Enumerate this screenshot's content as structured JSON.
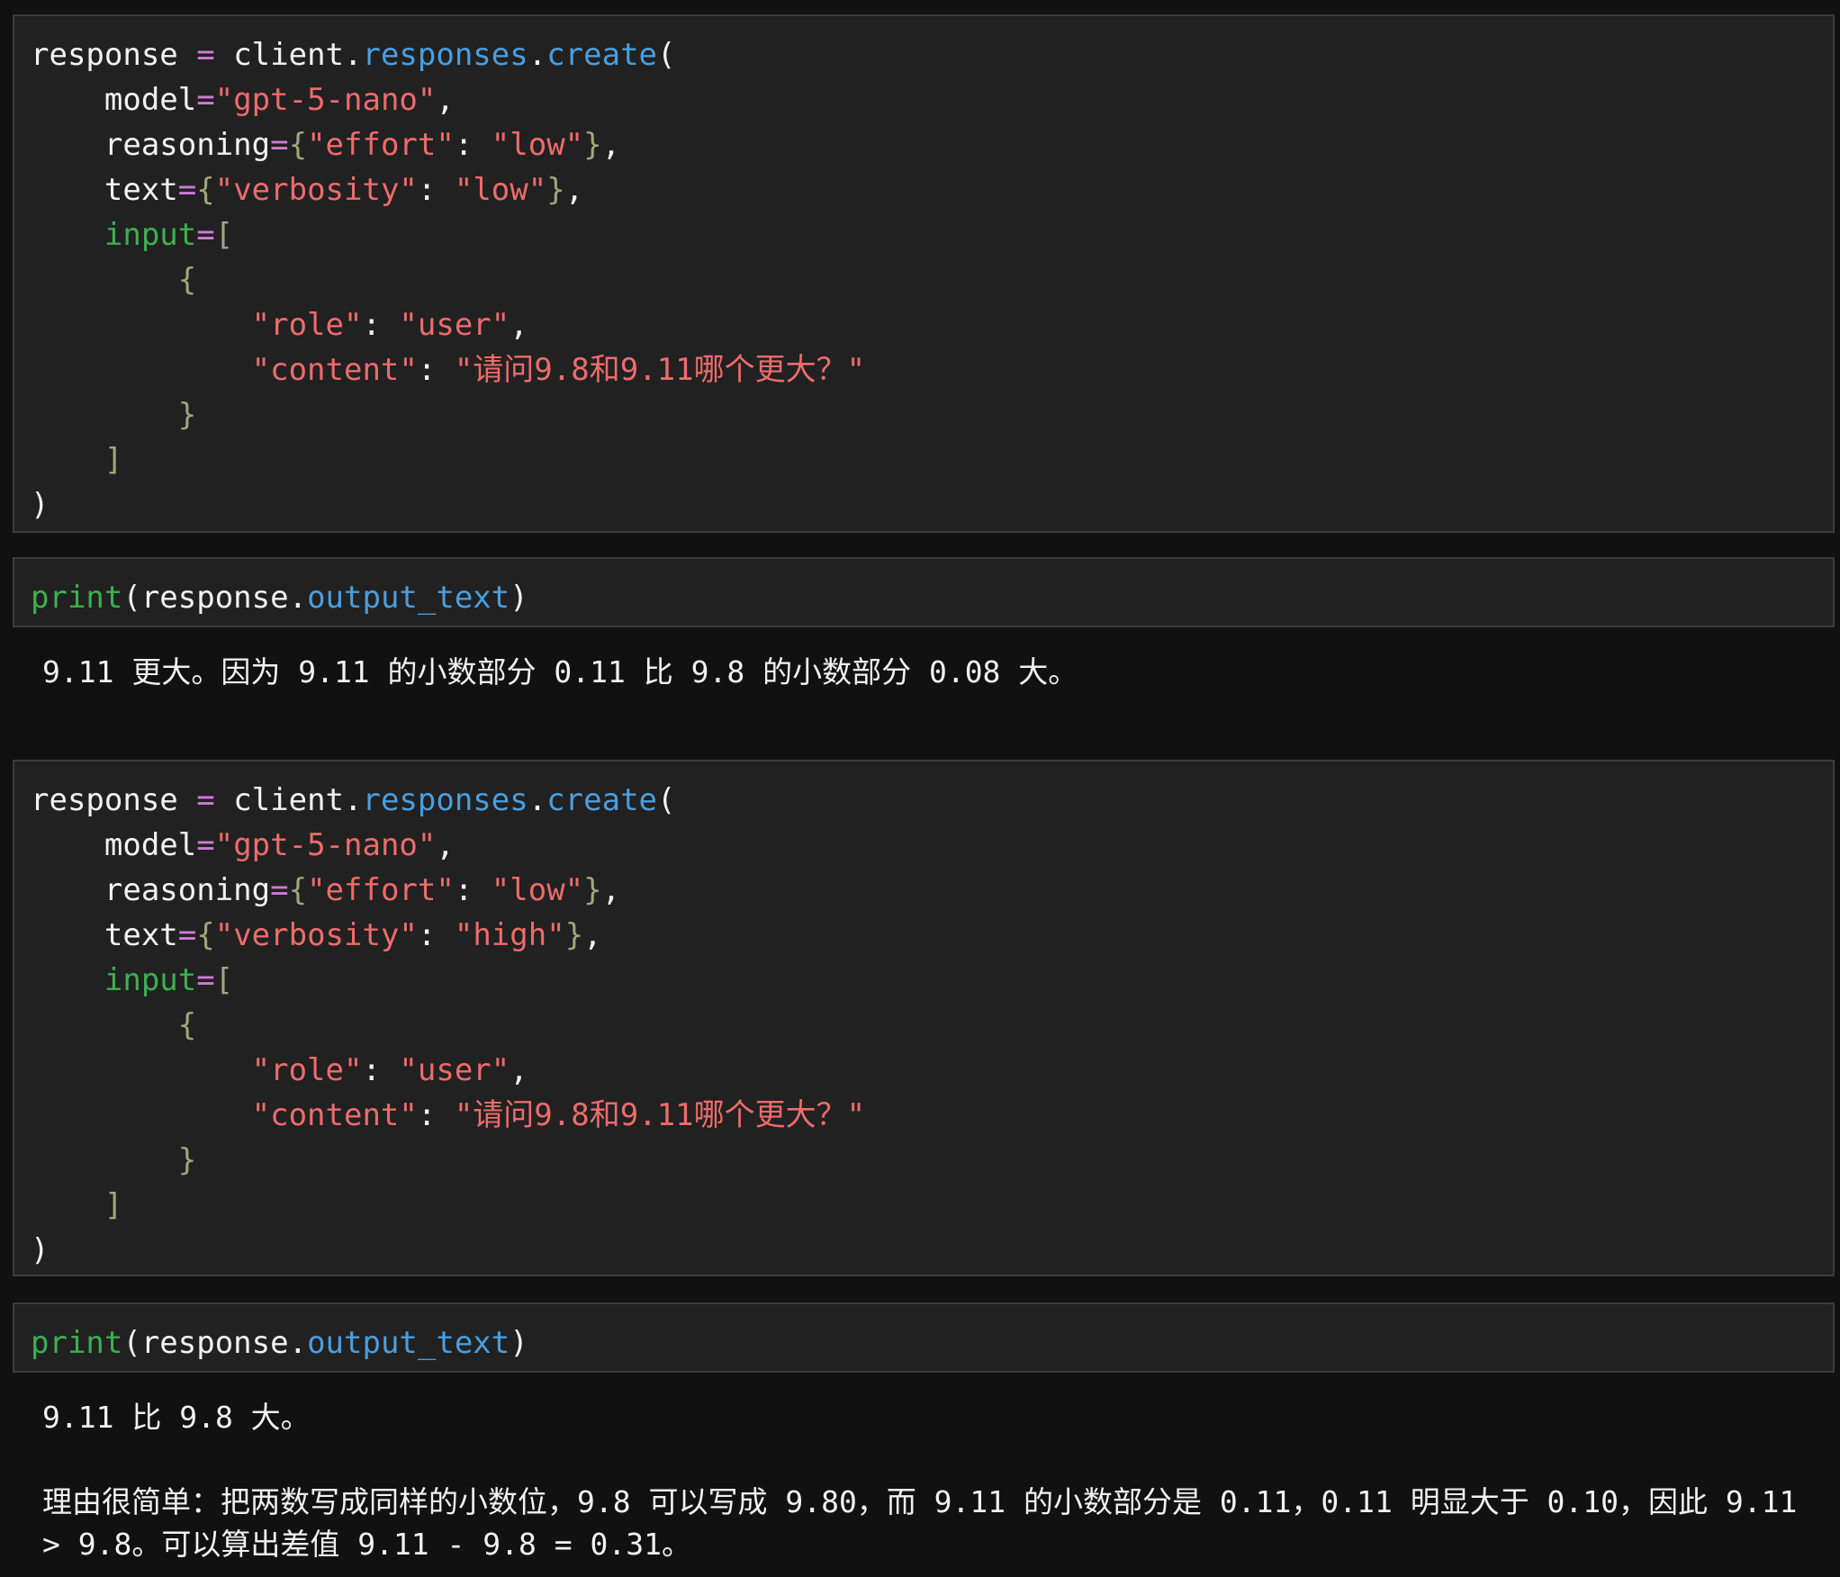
{
  "cells": [
    {
      "lines": [
        [
          [
            "plain",
            "response "
          ],
          [
            "op",
            "="
          ],
          [
            "plain",
            " client."
          ],
          [
            "attr",
            "responses"
          ],
          [
            "plain",
            "."
          ],
          [
            "attr",
            "create"
          ],
          [
            "plain",
            "("
          ]
        ],
        [
          [
            "plain",
            "    model"
          ],
          [
            "op",
            "="
          ],
          [
            "str",
            "\"gpt-5-nano\""
          ],
          [
            "plain",
            ","
          ]
        ],
        [
          [
            "plain",
            "    reasoning"
          ],
          [
            "op",
            "="
          ],
          [
            "punct",
            "{"
          ],
          [
            "str",
            "\"effort\""
          ],
          [
            "plain",
            ": "
          ],
          [
            "str",
            "\"low\""
          ],
          [
            "punct",
            "}"
          ],
          [
            "plain",
            ","
          ]
        ],
        [
          [
            "plain",
            "    text"
          ],
          [
            "op",
            "="
          ],
          [
            "punct",
            "{"
          ],
          [
            "str",
            "\"verbosity\""
          ],
          [
            "plain",
            ": "
          ],
          [
            "str",
            "\"low\""
          ],
          [
            "punct",
            "}"
          ],
          [
            "plain",
            ","
          ]
        ],
        [
          [
            "green",
            "    input"
          ],
          [
            "op",
            "="
          ],
          [
            "punct",
            "["
          ]
        ],
        [
          [
            "punct",
            "        {"
          ]
        ],
        [
          [
            "str",
            "            \"role\""
          ],
          [
            "plain",
            ": "
          ],
          [
            "str",
            "\"user\""
          ],
          [
            "plain",
            ","
          ]
        ],
        [
          [
            "str",
            "            \"content\""
          ],
          [
            "plain",
            ": "
          ],
          [
            "str",
            "\"请问9.8和9.11哪个更大？\""
          ]
        ],
        [
          [
            "punct",
            "        }"
          ]
        ],
        [
          [
            "punct",
            "    ]"
          ]
        ],
        [
          [
            "plain",
            ")"
          ]
        ]
      ]
    },
    {
      "lines": [
        [
          [
            "green",
            "print"
          ],
          [
            "plain",
            "(response."
          ],
          [
            "attr",
            "output_text"
          ],
          [
            "plain",
            ")"
          ]
        ]
      ]
    },
    {
      "lines": [
        [
          [
            "plain",
            "response "
          ],
          [
            "op",
            "="
          ],
          [
            "plain",
            " client."
          ],
          [
            "attr",
            "responses"
          ],
          [
            "plain",
            "."
          ],
          [
            "attr",
            "create"
          ],
          [
            "plain",
            "("
          ]
        ],
        [
          [
            "plain",
            "    model"
          ],
          [
            "op",
            "="
          ],
          [
            "str",
            "\"gpt-5-nano\""
          ],
          [
            "plain",
            ","
          ]
        ],
        [
          [
            "plain",
            "    reasoning"
          ],
          [
            "op",
            "="
          ],
          [
            "punct",
            "{"
          ],
          [
            "str",
            "\"effort\""
          ],
          [
            "plain",
            ": "
          ],
          [
            "str",
            "\"low\""
          ],
          [
            "punct",
            "}"
          ],
          [
            "plain",
            ","
          ]
        ],
        [
          [
            "plain",
            "    text"
          ],
          [
            "op",
            "="
          ],
          [
            "punct",
            "{"
          ],
          [
            "str",
            "\"verbosity\""
          ],
          [
            "plain",
            ": "
          ],
          [
            "str",
            "\"high\""
          ],
          [
            "punct",
            "}"
          ],
          [
            "plain",
            ","
          ]
        ],
        [
          [
            "green",
            "    input"
          ],
          [
            "op",
            "="
          ],
          [
            "punct",
            "["
          ]
        ],
        [
          [
            "punct",
            "        {"
          ]
        ],
        [
          [
            "str",
            "            \"role\""
          ],
          [
            "plain",
            ": "
          ],
          [
            "str",
            "\"user\""
          ],
          [
            "plain",
            ","
          ]
        ],
        [
          [
            "str",
            "            \"content\""
          ],
          [
            "plain",
            ": "
          ],
          [
            "str",
            "\"请问9.8和9.11哪个更大？\""
          ]
        ],
        [
          [
            "punct",
            "        }"
          ]
        ],
        [
          [
            "punct",
            "    ]"
          ]
        ],
        [
          [
            "plain",
            ")"
          ]
        ]
      ]
    },
    {
      "lines": [
        [
          [
            "green",
            "print"
          ],
          [
            "plain",
            "(response."
          ],
          [
            "attr",
            "output_text"
          ],
          [
            "plain",
            ")"
          ]
        ]
      ]
    }
  ],
  "outputs": [
    "9.11 更大。因为 9.11 的小数部分 0.11 比 9.8 的小数部分 0.08 大。",
    "9.11 比 9.8 大。\n\n理由很简单：把两数写成同样的小数位，9.8 可以写成 9.80，而 9.11 的小数部分是 0.11，0.11 明显大于 0.10，因此 9.11 > 9.8。可以算出差值 9.11 - 9.8 = 0.31。"
  ]
}
